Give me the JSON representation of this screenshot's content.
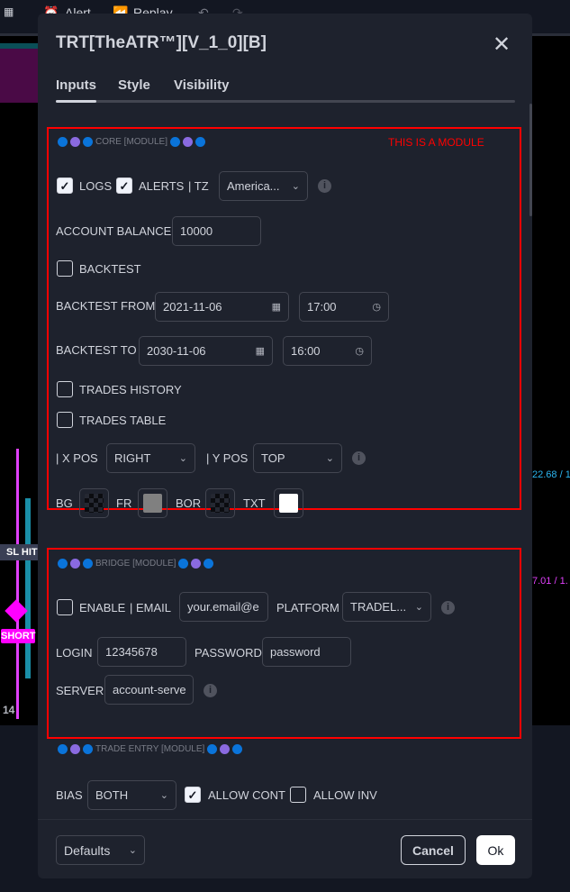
{
  "toolbar": {
    "alert": "Alert",
    "replay": "Replay"
  },
  "chart": {
    "sl_hit": "SL HIT",
    "short": "SHORT",
    "axis_label": "14",
    "value_a": "22.68 / 1",
    "value_b": "7.01 / 1."
  },
  "dialog": {
    "title": "TRT[TheATR™][V_1_0][B]",
    "tabs": [
      "Inputs",
      "Style",
      "Visibility"
    ],
    "active_tab": "Inputs",
    "annotation": "THIS IS A MODULE",
    "colors": {
      "dot_blue": "#0a74da",
      "dot_purple": "#8a6ae0",
      "module_border": "#ff0000",
      "txt_swatch": "#ffffff",
      "fr_swatch": "#808080"
    },
    "core": {
      "header": "CORE [MODULE]",
      "logs": {
        "label": "LOGS",
        "checked": true
      },
      "alerts": {
        "label": "ALERTS",
        "checked": true
      },
      "tz_label": "| TZ",
      "tz_value": "America...",
      "account_balance_label": "ACCOUNT BALANCE",
      "account_balance": "10000",
      "backtest": {
        "label": "BACKTEST",
        "checked": false
      },
      "backtest_from_label": "BACKTEST FROM",
      "backtest_from_date": "2021-11-06",
      "backtest_from_time": "17:00",
      "backtest_to_label": "BACKTEST TO",
      "backtest_to_date": "2030-11-06",
      "backtest_to_time": "16:00",
      "trades_history": {
        "label": "TRADES HISTORY",
        "checked": false
      },
      "trades_table": {
        "label": "TRADES TABLE",
        "checked": false
      },
      "x_pos_label": "| X POS",
      "x_pos": "RIGHT",
      "y_pos_label": "| Y POS",
      "y_pos": "TOP",
      "bg_label": "BG",
      "fr_label": "FR",
      "bor_label": "BOR",
      "txt_label": "TXT"
    },
    "bridge": {
      "header": "BRIDGE [MODULE]",
      "enable": {
        "label": "ENABLE",
        "checked": false
      },
      "email_label": "| EMAIL",
      "email": "your.email@e",
      "platform_label": "PLATFORM",
      "platform": "TRADEL...",
      "login_label": "LOGIN",
      "login": "12345678",
      "password_label": "PASSWORD",
      "password": "password",
      "server_label": "SERVER",
      "server": "account-serve"
    },
    "trade_entry": {
      "header": "TRADE ENTRY [MODULE]",
      "bias_label": "BIAS",
      "bias": "BOTH",
      "allow_cont": {
        "label": "ALLOW CONT",
        "checked": true
      },
      "allow_inv": {
        "label": "ALLOW INV",
        "checked": false
      }
    },
    "footer": {
      "defaults": "Defaults",
      "cancel": "Cancel",
      "ok": "Ok"
    }
  }
}
